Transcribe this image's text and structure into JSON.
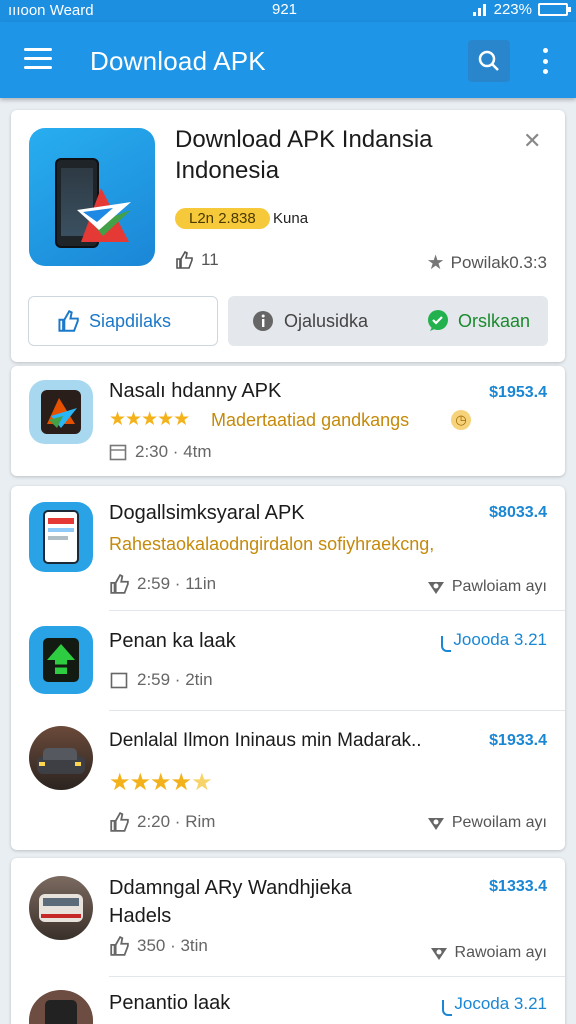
{
  "status_bar": {
    "left": "ıııoon Weard",
    "center": "921",
    "right": "223%"
  },
  "app_bar": {
    "title": "Download APK"
  },
  "featured": {
    "title_line1": "Download APK Indansia",
    "title_line2": "Indonesia",
    "badge": "L2n 2.838",
    "badge_note": "Kuna",
    "like_count": "11",
    "downloads": "Powilak0.3:3",
    "buttons": {
      "primary": "Siapdilaks",
      "secondary": "Ojalusidka",
      "tertiary": "Orslkaan"
    }
  },
  "list": [
    {
      "title": "Nasalı hdanny APK",
      "price": "$1953.4",
      "subtitle": "Madertaatiad gandkangs",
      "meta": "2:30 · 4tm",
      "icon": "app-arrow-icon"
    },
    {
      "title": "Dogallsimksyaral APK",
      "price": "$8033.4",
      "subtitle": "Rahestaokalaodngirdalon sofiyhraekcng,",
      "meta": "2:59 · 11in",
      "downloads": "Pawloiam ayı",
      "icon": "phone-app-icon"
    },
    {
      "title": "Penan ka laak",
      "price": "Joooda 3.21",
      "meta": "2:59 · 2tin",
      "icon": "green-arrow-app-icon"
    },
    {
      "title": "Denlalal Ilmon Ininaus min Madarak..",
      "price": "$1933.4",
      "meta": "2:20 · Rim",
      "downloads": "Pewoilam ayı",
      "icon": "car-app-icon"
    },
    {
      "title_line1": "Ddamngal ARy Wandhjieka",
      "title_line2": "Hadels",
      "price": "$1333.4",
      "meta": "350 · 3tin",
      "downloads": "Rawoiam ayı",
      "icon": "van-app-icon"
    },
    {
      "title": "Penantio laak",
      "price": "Jocoda 3.21",
      "icon": "phone-app-icon"
    }
  ],
  "colors": {
    "accent": "#1e95e6",
    "price": "#1a87d4",
    "star": "#f3b21b",
    "badge": "#f6c93a"
  }
}
